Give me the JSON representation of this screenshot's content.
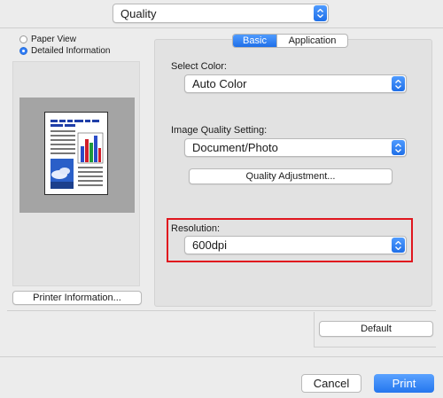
{
  "panel_popup": {
    "value": "Quality"
  },
  "view_options": [
    {
      "label": "Paper View",
      "selected": false
    },
    {
      "label": "Detailed Information",
      "selected": true
    }
  ],
  "preview": {
    "printer_info_button": "Printer Information..."
  },
  "tabs": [
    {
      "label": "Basic",
      "active": true
    },
    {
      "label": "Application",
      "active": false
    }
  ],
  "basic": {
    "select_color": {
      "label": "Select Color:",
      "value": "Auto Color"
    },
    "image_quality": {
      "label": "Image Quality Setting:",
      "value": "Document/Photo"
    },
    "quality_adjustment_button": "Quality Adjustment...",
    "resolution": {
      "label": "Resolution:",
      "value": "600dpi"
    }
  },
  "default_button": "Default",
  "footer": {
    "cancel_label": "Cancel",
    "print_label": "Print"
  },
  "colors": {
    "accent": "#2476ee",
    "highlight": "#e0161e"
  }
}
